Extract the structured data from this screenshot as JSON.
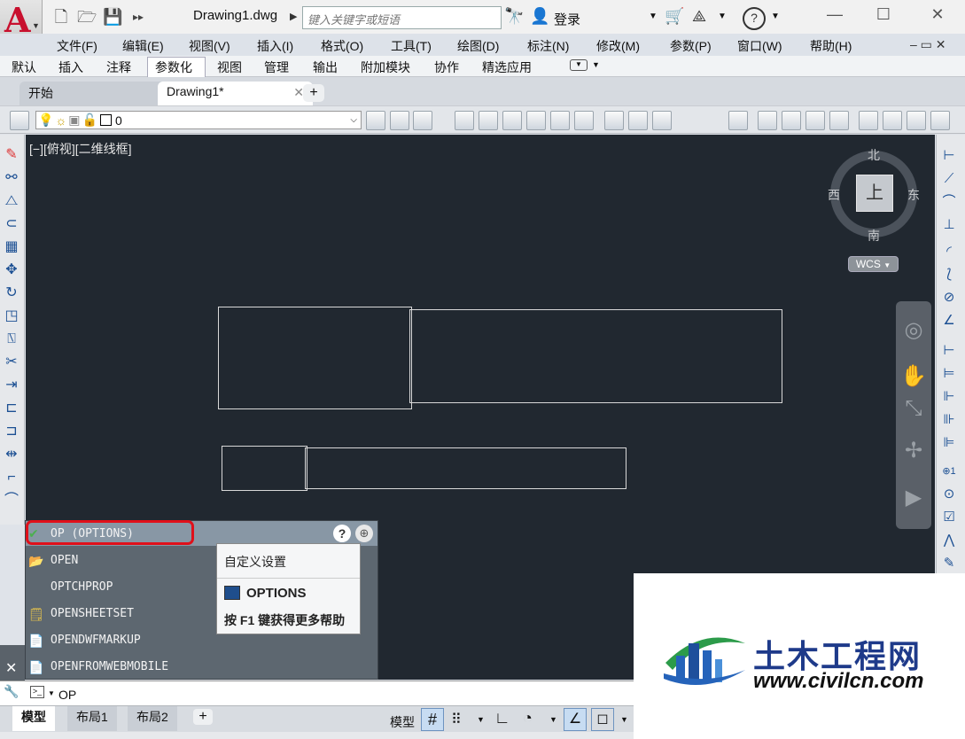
{
  "app": {
    "logo_letter": "A",
    "document_title": "Drawing1.dwg"
  },
  "search": {
    "placeholder": "键入关键字或短语"
  },
  "account": {
    "login_label": "登录"
  },
  "menubar": [
    "文件(F)",
    "编辑(E)",
    "视图(V)",
    "插入(I)",
    "格式(O)",
    "工具(T)",
    "绘图(D)",
    "标注(N)",
    "修改(M)",
    "参数(P)",
    "窗口(W)",
    "帮助(H)"
  ],
  "ribbon_tabs": [
    "默认",
    "插入",
    "注释",
    "参数化",
    "视图",
    "管理",
    "输出",
    "附加模块",
    "协作",
    "精选应用"
  ],
  "ribbon_active": "参数化",
  "doc_tabs": {
    "start": "开始",
    "drawing": "Drawing1*"
  },
  "layer": {
    "value": "0"
  },
  "viewport": {
    "label": "[−][俯视][二维线框]"
  },
  "viewcube": {
    "north": "北",
    "south": "南",
    "east": "东",
    "west": "西",
    "face": "上",
    "wcs": "WCS"
  },
  "command_popup": {
    "items": [
      {
        "label": "OP (OPTIONS)",
        "icon": "check-icon"
      },
      {
        "label": "OPEN",
        "icon": "folder-open-icon"
      },
      {
        "label": "OPTCHPROP",
        "icon": ""
      },
      {
        "label": "OPENSHEETSET",
        "icon": "sheetset-icon"
      },
      {
        "label": "OPENDWFMARKUP",
        "icon": "dwf-markup-icon"
      },
      {
        "label": "OPENFROMWEBMOBILE",
        "icon": "web-mobile-icon"
      }
    ],
    "tooltip": {
      "title": "自定义设置",
      "command": "OPTIONS",
      "help": "按 F1 键获得更多帮助"
    }
  },
  "command_line": {
    "input": "OP"
  },
  "layout_tabs": [
    "模型",
    "布局1",
    "布局2"
  ],
  "status": {
    "model_label": "模型"
  },
  "watermark": {
    "cn": "土木工程网",
    "url": "www.civilcn.com"
  },
  "colors": {
    "canvas": "#212830",
    "highlight": "#e0101a",
    "logo_red": "#c8102e"
  }
}
